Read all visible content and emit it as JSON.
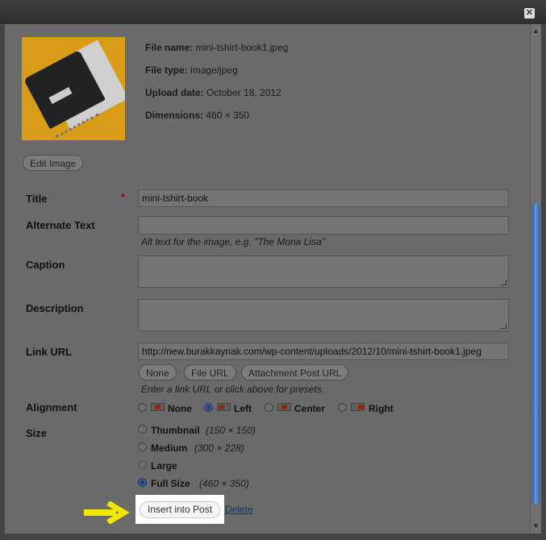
{
  "window": {
    "close_label": "✕"
  },
  "file_info": {
    "name_label": "File name:",
    "name_value": "mini-tshirt-book1.jpeg",
    "type_label": "File type:",
    "type_value": "image/jpeg",
    "date_label": "Upload date:",
    "date_value": "October 18, 2012",
    "dim_label": "Dimensions:",
    "dim_value": "460 × 350"
  },
  "edit_image_label": "Edit Image",
  "form": {
    "title_label": "Title",
    "required_mark": "*",
    "title_value": "mini-tshirt-book",
    "alt_label": "Alternate Text",
    "alt_value": "",
    "alt_hint": "Alt text for the image, e.g. \"The Mona Lisa\"",
    "caption_label": "Caption",
    "caption_value": "",
    "description_label": "Description",
    "description_value": "",
    "link_label": "Link URL",
    "link_value": "http://new.burakkaynak.com/wp-content/uploads/2012/10/mini-tshirt-book1.jpeg",
    "link_buttons": [
      "None",
      "File URL",
      "Attachment Post URL"
    ],
    "link_hint": "Enter a link URL or click above for presets.",
    "alignment_label": "Alignment",
    "alignment_options": [
      "None",
      "Left",
      "Center",
      "Right"
    ],
    "alignment_selected": "Left",
    "size_label": "Size",
    "size_options": [
      {
        "label": "Thumbnail",
        "dims": "(150 × 150)"
      },
      {
        "label": "Medium",
        "dims": "(300 × 228)"
      },
      {
        "label": "Large",
        "dims": ""
      },
      {
        "label": "Full Size",
        "dims": "(460 × 350)"
      }
    ],
    "size_selected": "Full Size"
  },
  "actions": {
    "insert_label": "Insert into Post",
    "delete_label": "Delete"
  },
  "colors": {
    "highlight_arrow": "#f2e600",
    "selected_radio": "#3d5e93",
    "scroll_thumb": "#4a7cc7"
  },
  "icons": {
    "close": "close-icon",
    "arrow": "right-arrow-icon"
  }
}
